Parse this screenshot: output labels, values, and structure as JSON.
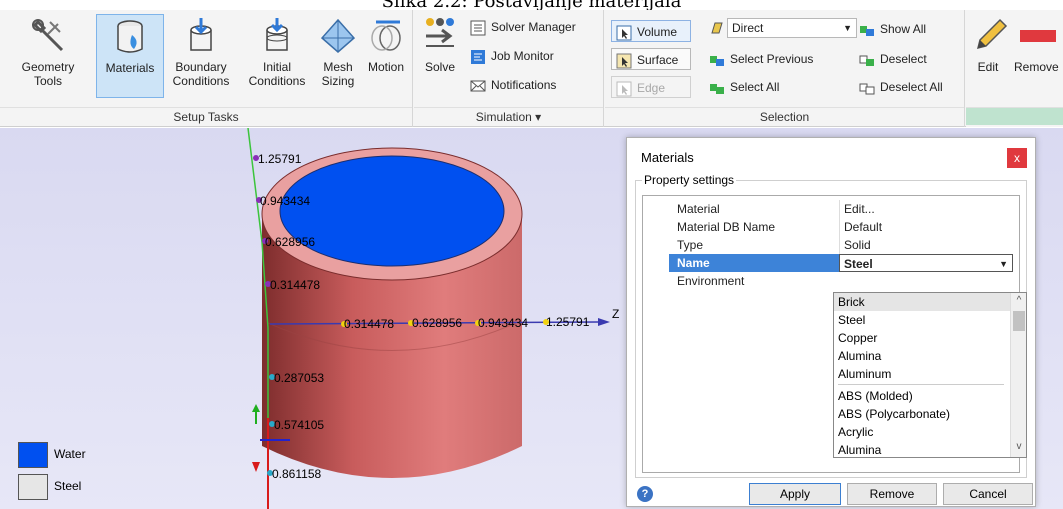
{
  "caption": "Slika 2.2: Postavljanje materijala",
  "ribbon": {
    "setup_tasks": {
      "label": "Setup Tasks",
      "buttons": [
        {
          "label": "Geometry Tools",
          "icon": "wrench-icon"
        },
        {
          "label": "Materials",
          "icon": "materials-icon",
          "active": true
        },
        {
          "label": "Boundary Conditions",
          "icon": "boundary-conditions-icon"
        },
        {
          "label": "Initial Conditions",
          "icon": "initial-conditions-icon"
        },
        {
          "label": "Mesh Sizing",
          "icon": "mesh-sizing-icon"
        },
        {
          "label": "Motion",
          "icon": "motion-icon"
        }
      ]
    },
    "simulation": {
      "label": "Simulation",
      "solve": "Solve",
      "solver_manager": "Solver Manager",
      "job_monitor": "Job Monitor",
      "notifications": "Notifications"
    },
    "selection": {
      "label": "Selection",
      "volume": "Volume",
      "surface": "Surface",
      "edge": "Edge",
      "mode": "Direct",
      "select_previous": "Select Previous",
      "select_all": "Select All",
      "show_all": "Show All",
      "deselect": "Deselect",
      "deselect_all": "Deselect All"
    },
    "edit": "Edit",
    "remove": "Remove"
  },
  "axis_labels": {
    "y": [
      "1.25791",
      "0.943434",
      "0.628956",
      "0.314478",
      "0.287053",
      "0.574105",
      "0.861158"
    ],
    "z": [
      "0.314478",
      "0.628956",
      "0.943434",
      "1.25791"
    ],
    "z_axis": "Z"
  },
  "legend": [
    {
      "label": "Water",
      "color": "#0050f0"
    },
    {
      "label": "Steel",
      "color": "#e6e6e6"
    }
  ],
  "dialog": {
    "title": "Materials",
    "close": "x",
    "group_label": "Property settings",
    "properties": [
      {
        "key": "Material",
        "value": "Edit..."
      },
      {
        "key": "Material DB Name",
        "value": "Default"
      },
      {
        "key": "Type",
        "value": "Solid"
      },
      {
        "key": "Name",
        "value": "Steel"
      },
      {
        "key": "Environment",
        "value": ""
      }
    ],
    "material_options": [
      "Brick",
      "Steel",
      "Copper",
      "Alumina",
      "Aluminum",
      "ABS (Molded)",
      "ABS (Polycarbonate)",
      "Acrylic",
      "Alumina"
    ],
    "apply": "Apply",
    "remove": "Remove",
    "cancel": "Cancel"
  },
  "colors": {
    "accent": "#3d83d8",
    "cylinder": "#d96a6a",
    "water": "#0050f0",
    "y_axis": "#3cc43c",
    "z_axis": "#3a3ab0"
  }
}
